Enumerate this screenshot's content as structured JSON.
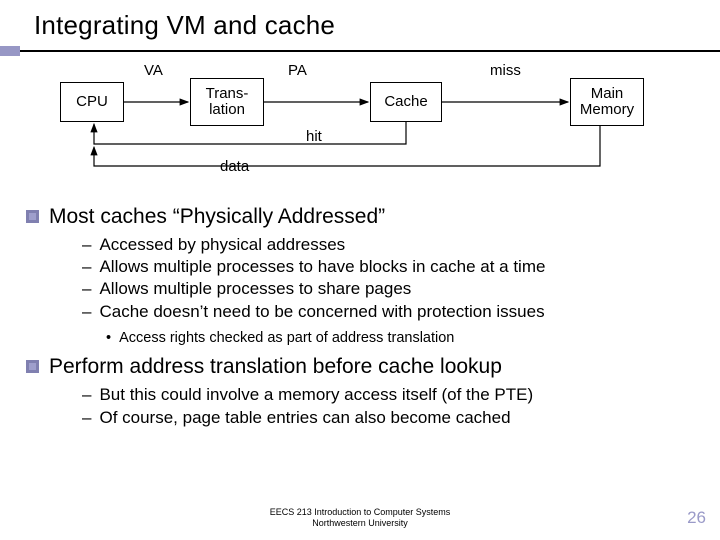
{
  "title": "Integrating VM and cache",
  "diagram": {
    "cpu": "CPU",
    "trans": "Trans-\nlation",
    "cache": "Cache",
    "mem": "Main\nMemory",
    "va": "VA",
    "pa": "PA",
    "miss": "miss",
    "hit": "hit",
    "data": "data"
  },
  "bullets": {
    "b1": "Most caches “Physically Addressed”",
    "b1_subs": {
      "s1": "Accessed by physical addresses",
      "s2": "Allows multiple processes to have blocks in cache at a time",
      "s3": "Allows multiple processes to share pages",
      "s4": "Cache doesn’t need to be concerned with protection issues"
    },
    "b1_subsubs": {
      "t1": "Access rights checked as part of address translation"
    },
    "b2": "Perform address translation before cache lookup",
    "b2_subs": {
      "s1": "But this could involve a memory access itself (of the PTE)",
      "s2": "Of course, page table entries can also become cached"
    }
  },
  "footer": {
    "line1": "EECS 213 Introduction to Computer Systems",
    "line2": "Northwestern University"
  },
  "pagenum": "26"
}
